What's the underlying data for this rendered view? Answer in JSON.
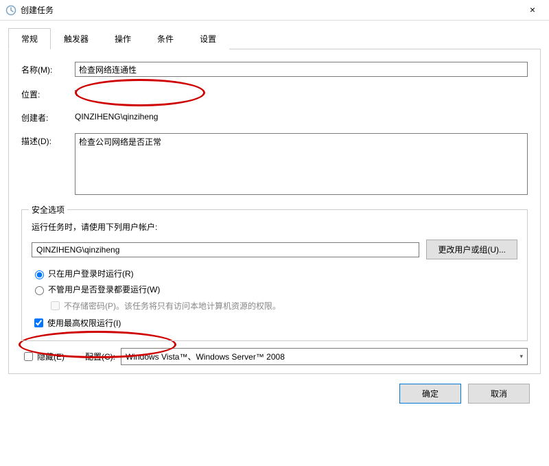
{
  "window": {
    "title": "创建任务",
    "close": "×"
  },
  "tabs": {
    "general": "常规",
    "triggers": "触发器",
    "actions": "操作",
    "conditions": "条件",
    "settings": "设置"
  },
  "general": {
    "name_label": "名称(M):",
    "name_value": "检查网络连通性",
    "location_label": "位置:",
    "location_value": "\\",
    "author_label": "创建者:",
    "author_value": "QINZIHENG\\qinziheng",
    "description_label": "描述(D):",
    "description_value": "检查公司网络是否正常"
  },
  "security": {
    "group_title": "安全选项",
    "account_hint": "运行任务时，请使用下列用户帐户:",
    "account_value": "QINZIHENG\\qinziheng",
    "change_user_btn": "更改用户或组(U)...",
    "radio_logged_on": "只在用户登录时运行(R)",
    "radio_any": "不管用户是否登录都要运行(W)",
    "no_store_pwd": "不存储密码(P)。该任务将只有访问本地计算机资源的权限。",
    "highest_priv": "使用最高权限运行(I)"
  },
  "bottom": {
    "hidden_cb": "隐藏(E)",
    "configure_label": "配置(C):",
    "configure_value": "Windows Vista™、Windows Server™ 2008"
  },
  "footer": {
    "ok": "确定",
    "cancel": "取消"
  }
}
